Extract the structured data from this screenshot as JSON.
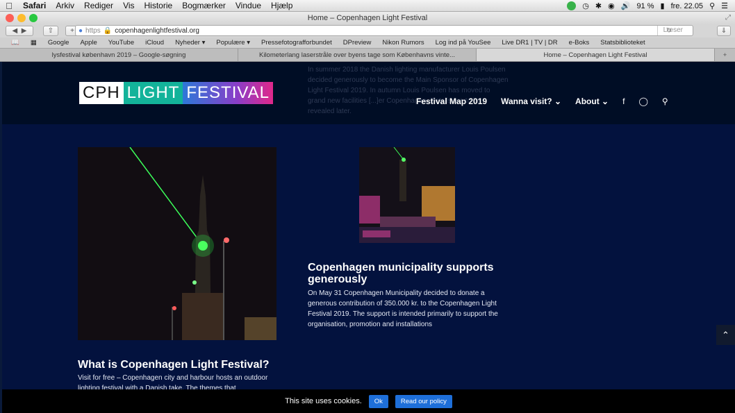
{
  "menubar": {
    "app": "Safari",
    "items": [
      "Arkiv",
      "Rediger",
      "Vis",
      "Historie",
      "Bogmærker",
      "Vindue",
      "Hjælp"
    ],
    "battery": "91 %",
    "clock": "fre. 22.05"
  },
  "window": {
    "title": "Home – Copenhagen Light Festival"
  },
  "url": {
    "scheme": "https",
    "host": "copenhagenlightfestival.org",
    "reader": "Læser"
  },
  "bookmarks": [
    "Google",
    "Apple",
    "YouTube",
    "iCloud",
    "Nyheder ▾",
    "Populære ▾",
    "Pressefotografforbundet",
    "DPreview",
    "Nikon Rumors",
    "Log ind på YouSee",
    "Live DR1 | TV | DR",
    "e-Boks",
    "Statsbiblioteket"
  ],
  "tabs": [
    {
      "label": "lysfestival københavn 2019 – Google-søgning"
    },
    {
      "label": "Kilometerlang laserstråle over byens tage som Københavns vinte..."
    },
    {
      "label": "Home – Copenhagen Light Festival"
    }
  ],
  "header": {
    "logo": {
      "part1": "CPH",
      "part2": "LIGHT",
      "part3": "FESTIVAL"
    },
    "ghost_text": "In summer 2018 the Danish lighting manufacturer Louis Poulsen decided generously to become the Main Sponsor of Copenhagen Light Festival 2019. In autumn Louis Poulsen has moved to grand new facilities [...]er Copenhagen. Details are to be revealed later.",
    "nav": {
      "map": "Festival Map 2019",
      "visit": "Wanna visit?",
      "about": "About"
    }
  },
  "posts": [
    {
      "title": "What is Copenhagen Light Festival?",
      "text": "Visit for free – Copenhagen city and harbour hosts an outdoor lighting festival with a Danish take. The themes that"
    },
    {
      "title": "Copenhagen municipality supports generously",
      "text": "On May 31 Copenhagen Municipality decided to donate a generous contribution of 350.000 kr. to the Copenhagen Light Festival 2019. The support is intended primarily to support the organisation, promotion and installations"
    }
  ],
  "cookie": {
    "text": "This site uses cookies.",
    "ok": "Ok",
    "policy": "Read our policy"
  }
}
